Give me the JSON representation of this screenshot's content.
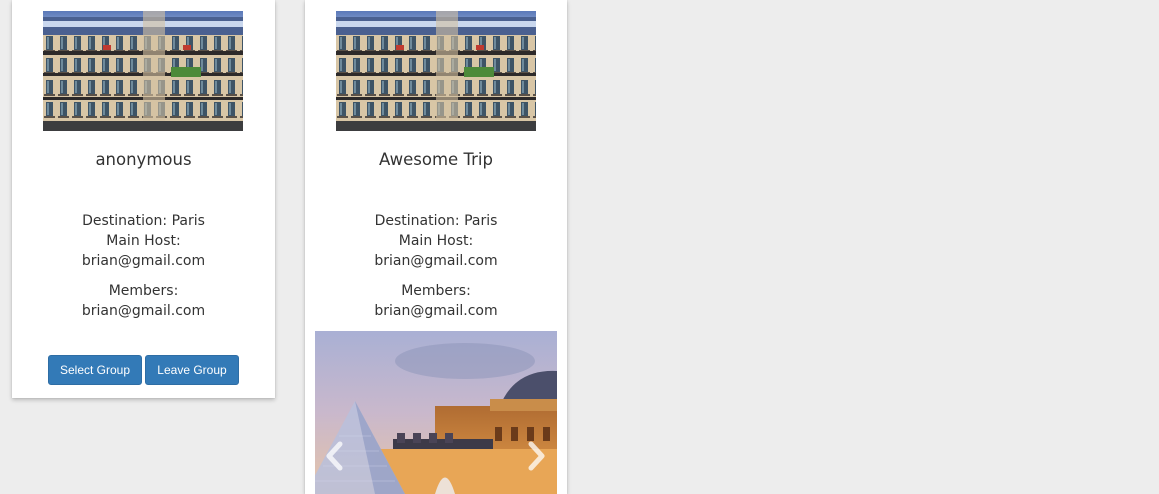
{
  "groups": [
    {
      "title": "anonymous",
      "destination": "Destination: Paris",
      "host_label": "Main Host:",
      "host_email": "brian@gmail.com",
      "members_label": "Members:",
      "member_email": "brian@gmail.com",
      "select_label": "Select Group",
      "leave_label": "Leave Group"
    },
    {
      "title": "Awesome Trip",
      "destination": "Destination: Paris",
      "host_label": "Main Host:",
      "host_email": "brian@gmail.com",
      "members_label": "Members:",
      "member_email": "brian@gmail.com"
    }
  ],
  "colors": {
    "page_bg": "#ededed",
    "button_bg": "#337ab7",
    "card_bg": "#ffffff"
  },
  "icons": {
    "carousel_prev": "chevron-left-icon",
    "carousel_next": "chevron-right-icon"
  }
}
